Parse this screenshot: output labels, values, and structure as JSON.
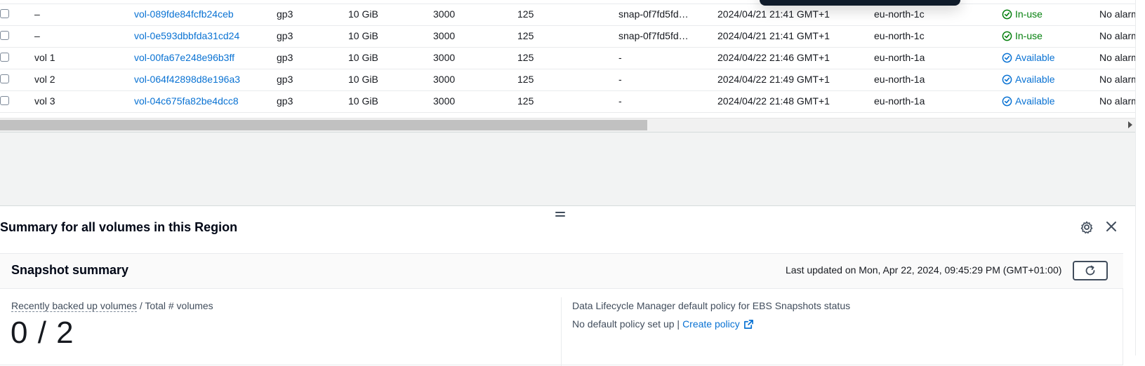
{
  "volumes": [
    {
      "name": "–",
      "volume_id": "vol-089fde84fcfb24ceb",
      "type": "gp3",
      "size": "10 GiB",
      "iops": "3000",
      "throughput": "125",
      "snapshot": "snap-0f7fd5fd…",
      "created": "2024/04/21 21:41 GMT+1",
      "az": "eu-north-1c",
      "state": "In-use",
      "alarm": "No alarms"
    },
    {
      "name": "–",
      "volume_id": "vol-0e593dbbfda31cd24",
      "type": "gp3",
      "size": "10 GiB",
      "iops": "3000",
      "throughput": "125",
      "snapshot": "snap-0f7fd5fd…",
      "created": "2024/04/21 21:41 GMT+1",
      "az": "eu-north-1c",
      "state": "In-use",
      "alarm": "No alarms"
    },
    {
      "name": "vol 1",
      "volume_id": "vol-00fa67e248e96b3ff",
      "type": "gp3",
      "size": "10 GiB",
      "iops": "3000",
      "throughput": "125",
      "snapshot": "-",
      "created": "2024/04/22 21:46 GMT+1",
      "az": "eu-north-1a",
      "state": "Available",
      "alarm": "No alarms"
    },
    {
      "name": "vol 2",
      "volume_id": "vol-064f42898d8e196a3",
      "type": "gp3",
      "size": "10 GiB",
      "iops": "3000",
      "throughput": "125",
      "snapshot": "-",
      "created": "2024/04/22 21:49 GMT+1",
      "az": "eu-north-1a",
      "state": "Available",
      "alarm": "No alarms"
    },
    {
      "name": "vol 3",
      "volume_id": "vol-04c675fa82be4dcc8",
      "type": "gp3",
      "size": "10 GiB",
      "iops": "3000",
      "throughput": "125",
      "snapshot": "-",
      "created": "2024/04/22 21:48 GMT+1",
      "az": "eu-north-1a",
      "state": "Available",
      "alarm": "No alarms"
    }
  ],
  "state_colors": {
    "In-use": "#037f0c",
    "Available": "#0972d3"
  },
  "state_icons": {
    "In-use": "check-circle-icon",
    "Available": "check-circle-icon"
  },
  "split_panel": {
    "title": "Summary for all volumes in this Region",
    "snapshot_summary": {
      "title": "Snapshot summary",
      "last_updated": "Last updated on Mon, Apr 22, 2024, 09:45:29 PM (GMT+01:00)",
      "metric_label_link": "Recently backed up volumes",
      "metric_label_rest": " / Total # volumes",
      "metric_value": "0 / 2",
      "dlm_label": "Data Lifecycle Manager default policy for EBS Snapshots status",
      "dlm_status": "No default policy set up |",
      "dlm_link": "Create policy"
    }
  },
  "icons": {
    "settings": "gear-icon",
    "close": "close-icon",
    "refresh": "refresh-icon",
    "external": "external-link-icon",
    "resize": "drag-handle-icon"
  }
}
